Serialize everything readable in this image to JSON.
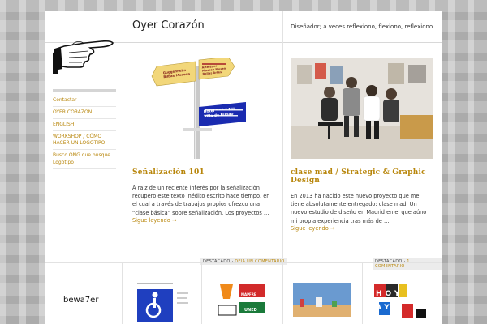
{
  "header": {
    "site_title": "Oyer Corazón",
    "tagline": "Diseñador; a veces reflexiono, flexiono, reflexiono."
  },
  "sidebar": {
    "items": [
      {
        "label": "Contactar"
      },
      {
        "label": "OYER CORAZÓN"
      },
      {
        "label": "ENGLISH"
      },
      {
        "label": "WORKSHOP / CÓMO HACER UN LOGOTIPO"
      },
      {
        "label": "Busco ONG que busque Logotipo"
      }
    ]
  },
  "posts": [
    {
      "title": "Señalización 101",
      "excerpt": "A raíz de un reciente interés por la señalización recupero este texto inédito escrito hace tiempo, en el cual a través de trabajos propios ofrezco una “clase básica” sobre señalización. Los proyectos …",
      "read_more": "Sigue leyendo →",
      "category": "DESTACADO",
      "comments": "DEJA UN COMENTARIO",
      "sign_text_1": "Guggenheim Bilbao Museoa",
      "sign_text_2": "Arte Eder Museoa Museo Bellas Artes",
      "sign_text_3": "Hotel * * * * NH Villa de Bilbao"
    },
    {
      "title": "clase mad / Strategic & Graphic Design",
      "excerpt": "En 2013 ha nacido este nuevo proyecto que me tiene absolutamente entregado: clase mad. Un nuevo estudio de diseño en Madrid en el que aúno mi propia experiencia tras más de …",
      "read_more": "Sigue leyendo →",
      "category": "DESTACADO",
      "comments": "1 COMENTARIO"
    }
  ],
  "thumbs": {
    "bewa_label": "bewa7er",
    "logo_text_1": "MAPFRE",
    "logo_text_2": "UNED",
    "poster_text": "HOY AY"
  },
  "colors": {
    "accent": "#b8860b",
    "blue_sign": "#1a2bb0",
    "yellow_sign": "#f2d77a"
  }
}
